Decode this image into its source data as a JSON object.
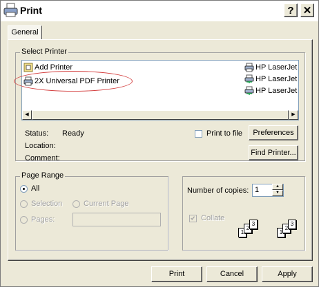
{
  "window": {
    "title": "Print",
    "help_label": "?",
    "close_label": "✕"
  },
  "tabs": [
    {
      "label": "General"
    }
  ],
  "select_printer": {
    "legend": "Select Printer",
    "printers": [
      {
        "name": "Add Printer",
        "icon": "add-printer-icon"
      },
      {
        "name": "2X Universal PDF Printer",
        "icon": "printer-icon"
      },
      {
        "name": "HP LaserJet",
        "icon": "printer-icon"
      },
      {
        "name": "HP LaserJet",
        "icon": "network-printer-icon"
      },
      {
        "name": "HP LaserJet",
        "icon": "network-printer-icon"
      }
    ],
    "status_label": "Status:",
    "status_value": "Ready",
    "location_label": "Location:",
    "location_value": "",
    "comment_label": "Comment:",
    "comment_value": "",
    "print_to_file_label": "Print to file",
    "preferences_label": "Preferences",
    "find_printer_label": "Find Printer..."
  },
  "page_range": {
    "legend": "Page Range",
    "all_label": "All",
    "selection_label": "Selection",
    "current_page_label": "Current Page",
    "pages_label": "Pages:",
    "pages_value": "",
    "selected": "All"
  },
  "copies": {
    "number_label": "Number of copies:",
    "value": "1",
    "collate_label": "Collate",
    "collate_checked": true,
    "page_numbers": [
      "1",
      "2",
      "3"
    ]
  },
  "footer": {
    "print_label": "Print",
    "cancel_label": "Cancel",
    "apply_label": "Apply"
  }
}
